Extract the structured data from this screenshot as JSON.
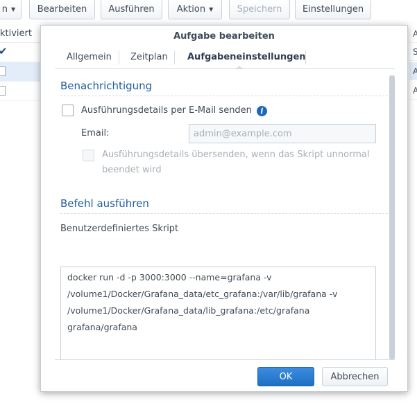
{
  "toolbar": {
    "buttons": [
      {
        "label": "n"
      },
      {
        "label": "Bearbeiten"
      },
      {
        "label": "Ausführen"
      },
      {
        "label": "Aktion"
      },
      {
        "label": "Speichern"
      },
      {
        "label": "Einstellungen"
      }
    ]
  },
  "background_table": {
    "column_header": "ktiviert",
    "right_column_letters": [
      "A",
      "S",
      "A",
      "A"
    ]
  },
  "dialog": {
    "title": "Aufgabe bearbeiten",
    "tabs": [
      {
        "label": "Allgemein"
      },
      {
        "label": "Zeitplan"
      },
      {
        "label": "Aufgabeneinstellungen"
      }
    ],
    "notification": {
      "section_title": "Benachrichtigung",
      "send_email_label": "Ausführungsdetails per E-Mail senden",
      "email_label": "Email:",
      "email_placeholder": "admin@example.com",
      "abnormal_only_label": "Ausführungsdetails übersenden, wenn das Skript unnormal beendet wird"
    },
    "command": {
      "section_title": "Befehl ausführen",
      "script_label": "Benutzerdefiniertes Skript",
      "script_text": "docker run -d -p 3000:3000 --name=grafana -v\n/volume1/Docker/Grafana_data/etc_grafana:/var/lib/grafana -v\n/volume1/Docker/Grafana_data/lib_grafana:/etc/grafana\ngrafana/grafana"
    },
    "ok_label": "OK",
    "cancel_label": "Abbrechen"
  }
}
